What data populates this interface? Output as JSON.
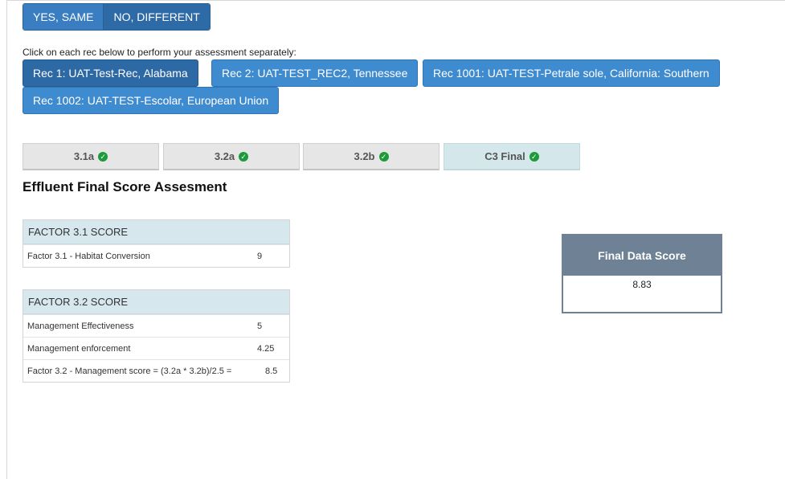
{
  "toggle": {
    "yes_label": "YES, SAME",
    "no_label": "NO, DIFFERENT"
  },
  "instruction": "Click on each rec below to perform your assessment separately:",
  "recs": [
    {
      "label": "Rec 1: UAT-Test-Rec, Alabama"
    },
    {
      "label": "Rec 2: UAT-TEST_REC2, Tennessee"
    },
    {
      "label": "Rec 1001: UAT-TEST-Petrale sole, California: Southern"
    },
    {
      "label": "Rec 1002: UAT-TEST-Escolar, European Union"
    }
  ],
  "tabs": [
    {
      "label": "3.1a"
    },
    {
      "label": "3.2a"
    },
    {
      "label": "3.2b"
    },
    {
      "label": "C3 Final"
    }
  ],
  "heading": "Effluent Final Score Assesment",
  "factor31": {
    "title": "FACTOR 3.1 SCORE",
    "rows": [
      {
        "label": "Factor 3.1 - Habitat Conversion",
        "value": "9"
      }
    ]
  },
  "factor32": {
    "title": "FACTOR 3.2 SCORE",
    "rows": [
      {
        "label": "Management Effectiveness",
        "value": "5"
      },
      {
        "label": "Management enforcement",
        "value": "4.25"
      },
      {
        "label": "Factor 3.2 - Management score = (3.2a * 3.2b)/2.5 =",
        "value": "8.5"
      }
    ]
  },
  "final": {
    "title": "Final Data Score",
    "value": "8.83"
  },
  "colors": {
    "accent": "#3f8bd0",
    "active": "#2d69a5",
    "check": "#1d9a3a",
    "final_header": "#6f8194"
  },
  "icons": {
    "tab_status": "check-circle-icon"
  }
}
